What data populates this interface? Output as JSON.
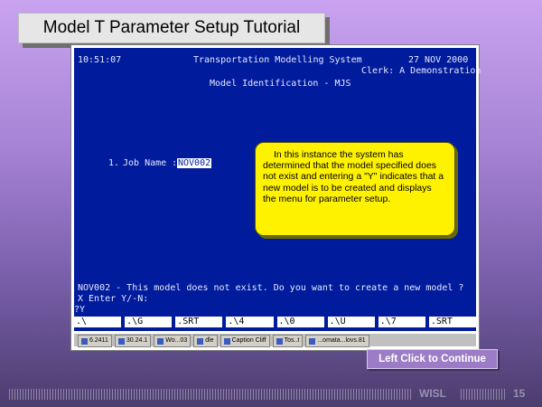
{
  "slide": {
    "title": "Model T Parameter Setup Tutorial",
    "continue_label": "Left Click to Continue",
    "footer_label": "WISL",
    "page_number": "15"
  },
  "terminal": {
    "time": "10:51:07",
    "system_name": "Transportation Modelling System",
    "date": "27 NOV 2000",
    "clerk": "Clerk: A Demonstration",
    "screen_title": "Model Identification - MJS",
    "job_number": "1.",
    "job_label": "Job Name :",
    "job_value": "NOV002",
    "message_line": "NOV002 - This model does not exist. Do you want to create a new model ?",
    "prompt_line": "X Enter Y/-N:",
    "input_line": "?Y",
    "function_keys": [
      ".\\",
      ".\\G",
      ".SRT",
      ".\\4",
      ".\\0",
      ".\\U",
      ".\\7",
      ".SRT"
    ]
  },
  "callout": {
    "text": "In this instance the system has determined that the model specified does not exist and entering a \"Y\" indicates that a new model is to be created and displays the menu for parameter setup."
  },
  "taskbar": {
    "items": [
      "6.2411",
      "30.24.1",
      "Wo...03",
      "dle",
      "Caption Cliff",
      "Tos..t",
      "...omata...lovs.81"
    ]
  },
  "colors": {
    "terminal_bg": "#001c9c",
    "callout_bg": "#fff200",
    "slide_bg_top": "#c9a3f0",
    "slide_bg_bottom": "#4b3d6e"
  }
}
